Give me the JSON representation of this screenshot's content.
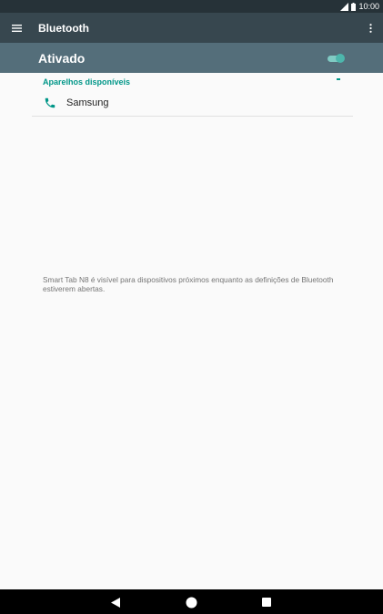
{
  "status_bar": {
    "time": "10:00"
  },
  "app_bar": {
    "title": "Bluetooth",
    "menu_icon": "hamburger-menu-icon",
    "more_icon": "more-vert-icon"
  },
  "master_switch": {
    "label": "Ativado",
    "state": "on",
    "accent_color": "#4db6ac"
  },
  "available_devices": {
    "header": "Aparelhos disponíveis",
    "items": [
      {
        "name": "Samsung",
        "icon": "phone-icon"
      }
    ]
  },
  "visibility_note": "Smart Tab N8 é visível para dispositivos próximos enquanto as definições de Bluetooth estiverem abertas.",
  "navigation": {
    "back_icon": "back-triangle-icon",
    "home_icon": "home-circle-icon",
    "recents_icon": "recents-square-icon"
  },
  "colors": {
    "status_bar": "#263238",
    "app_bar": "#37474f",
    "switch_bar": "#546e7a",
    "accent": "#009688"
  }
}
